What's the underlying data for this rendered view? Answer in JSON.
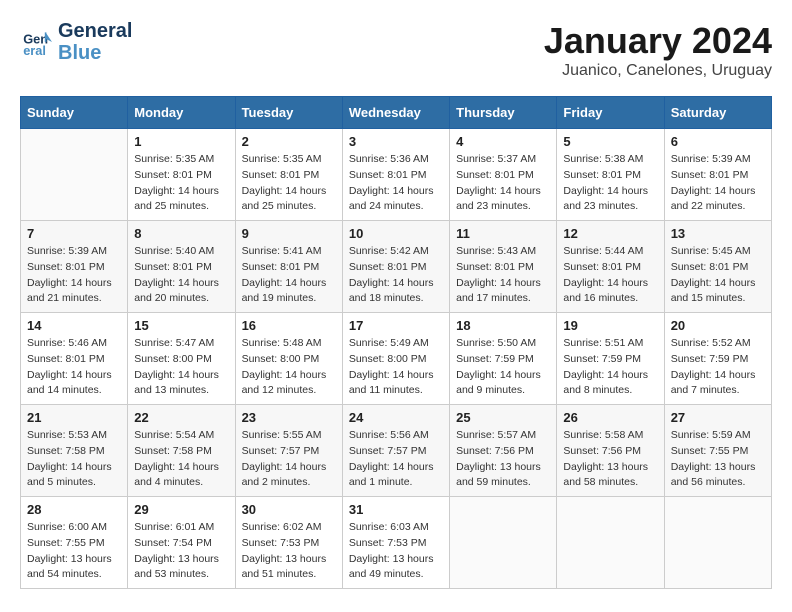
{
  "logo": {
    "line1": "General",
    "line2": "Blue"
  },
  "title": "January 2024",
  "subtitle": "Juanico, Canelones, Uruguay",
  "days_header": [
    "Sunday",
    "Monday",
    "Tuesday",
    "Wednesday",
    "Thursday",
    "Friday",
    "Saturday"
  ],
  "weeks": [
    [
      {
        "num": "",
        "info": ""
      },
      {
        "num": "1",
        "info": "Sunrise: 5:35 AM\nSunset: 8:01 PM\nDaylight: 14 hours\nand 25 minutes."
      },
      {
        "num": "2",
        "info": "Sunrise: 5:35 AM\nSunset: 8:01 PM\nDaylight: 14 hours\nand 25 minutes."
      },
      {
        "num": "3",
        "info": "Sunrise: 5:36 AM\nSunset: 8:01 PM\nDaylight: 14 hours\nand 24 minutes."
      },
      {
        "num": "4",
        "info": "Sunrise: 5:37 AM\nSunset: 8:01 PM\nDaylight: 14 hours\nand 23 minutes."
      },
      {
        "num": "5",
        "info": "Sunrise: 5:38 AM\nSunset: 8:01 PM\nDaylight: 14 hours\nand 23 minutes."
      },
      {
        "num": "6",
        "info": "Sunrise: 5:39 AM\nSunset: 8:01 PM\nDaylight: 14 hours\nand 22 minutes."
      }
    ],
    [
      {
        "num": "7",
        "info": "Sunrise: 5:39 AM\nSunset: 8:01 PM\nDaylight: 14 hours\nand 21 minutes."
      },
      {
        "num": "8",
        "info": "Sunrise: 5:40 AM\nSunset: 8:01 PM\nDaylight: 14 hours\nand 20 minutes."
      },
      {
        "num": "9",
        "info": "Sunrise: 5:41 AM\nSunset: 8:01 PM\nDaylight: 14 hours\nand 19 minutes."
      },
      {
        "num": "10",
        "info": "Sunrise: 5:42 AM\nSunset: 8:01 PM\nDaylight: 14 hours\nand 18 minutes."
      },
      {
        "num": "11",
        "info": "Sunrise: 5:43 AM\nSunset: 8:01 PM\nDaylight: 14 hours\nand 17 minutes."
      },
      {
        "num": "12",
        "info": "Sunrise: 5:44 AM\nSunset: 8:01 PM\nDaylight: 14 hours\nand 16 minutes."
      },
      {
        "num": "13",
        "info": "Sunrise: 5:45 AM\nSunset: 8:01 PM\nDaylight: 14 hours\nand 15 minutes."
      }
    ],
    [
      {
        "num": "14",
        "info": "Sunrise: 5:46 AM\nSunset: 8:01 PM\nDaylight: 14 hours\nand 14 minutes."
      },
      {
        "num": "15",
        "info": "Sunrise: 5:47 AM\nSunset: 8:00 PM\nDaylight: 14 hours\nand 13 minutes."
      },
      {
        "num": "16",
        "info": "Sunrise: 5:48 AM\nSunset: 8:00 PM\nDaylight: 14 hours\nand 12 minutes."
      },
      {
        "num": "17",
        "info": "Sunrise: 5:49 AM\nSunset: 8:00 PM\nDaylight: 14 hours\nand 11 minutes."
      },
      {
        "num": "18",
        "info": "Sunrise: 5:50 AM\nSunset: 7:59 PM\nDaylight: 14 hours\nand 9 minutes."
      },
      {
        "num": "19",
        "info": "Sunrise: 5:51 AM\nSunset: 7:59 PM\nDaylight: 14 hours\nand 8 minutes."
      },
      {
        "num": "20",
        "info": "Sunrise: 5:52 AM\nSunset: 7:59 PM\nDaylight: 14 hours\nand 7 minutes."
      }
    ],
    [
      {
        "num": "21",
        "info": "Sunrise: 5:53 AM\nSunset: 7:58 PM\nDaylight: 14 hours\nand 5 minutes."
      },
      {
        "num": "22",
        "info": "Sunrise: 5:54 AM\nSunset: 7:58 PM\nDaylight: 14 hours\nand 4 minutes."
      },
      {
        "num": "23",
        "info": "Sunrise: 5:55 AM\nSunset: 7:57 PM\nDaylight: 14 hours\nand 2 minutes."
      },
      {
        "num": "24",
        "info": "Sunrise: 5:56 AM\nSunset: 7:57 PM\nDaylight: 14 hours\nand 1 minute."
      },
      {
        "num": "25",
        "info": "Sunrise: 5:57 AM\nSunset: 7:56 PM\nDaylight: 13 hours\nand 59 minutes."
      },
      {
        "num": "26",
        "info": "Sunrise: 5:58 AM\nSunset: 7:56 PM\nDaylight: 13 hours\nand 58 minutes."
      },
      {
        "num": "27",
        "info": "Sunrise: 5:59 AM\nSunset: 7:55 PM\nDaylight: 13 hours\nand 56 minutes."
      }
    ],
    [
      {
        "num": "28",
        "info": "Sunrise: 6:00 AM\nSunset: 7:55 PM\nDaylight: 13 hours\nand 54 minutes."
      },
      {
        "num": "29",
        "info": "Sunrise: 6:01 AM\nSunset: 7:54 PM\nDaylight: 13 hours\nand 53 minutes."
      },
      {
        "num": "30",
        "info": "Sunrise: 6:02 AM\nSunset: 7:53 PM\nDaylight: 13 hours\nand 51 minutes."
      },
      {
        "num": "31",
        "info": "Sunrise: 6:03 AM\nSunset: 7:53 PM\nDaylight: 13 hours\nand 49 minutes."
      },
      {
        "num": "",
        "info": ""
      },
      {
        "num": "",
        "info": ""
      },
      {
        "num": "",
        "info": ""
      }
    ]
  ]
}
